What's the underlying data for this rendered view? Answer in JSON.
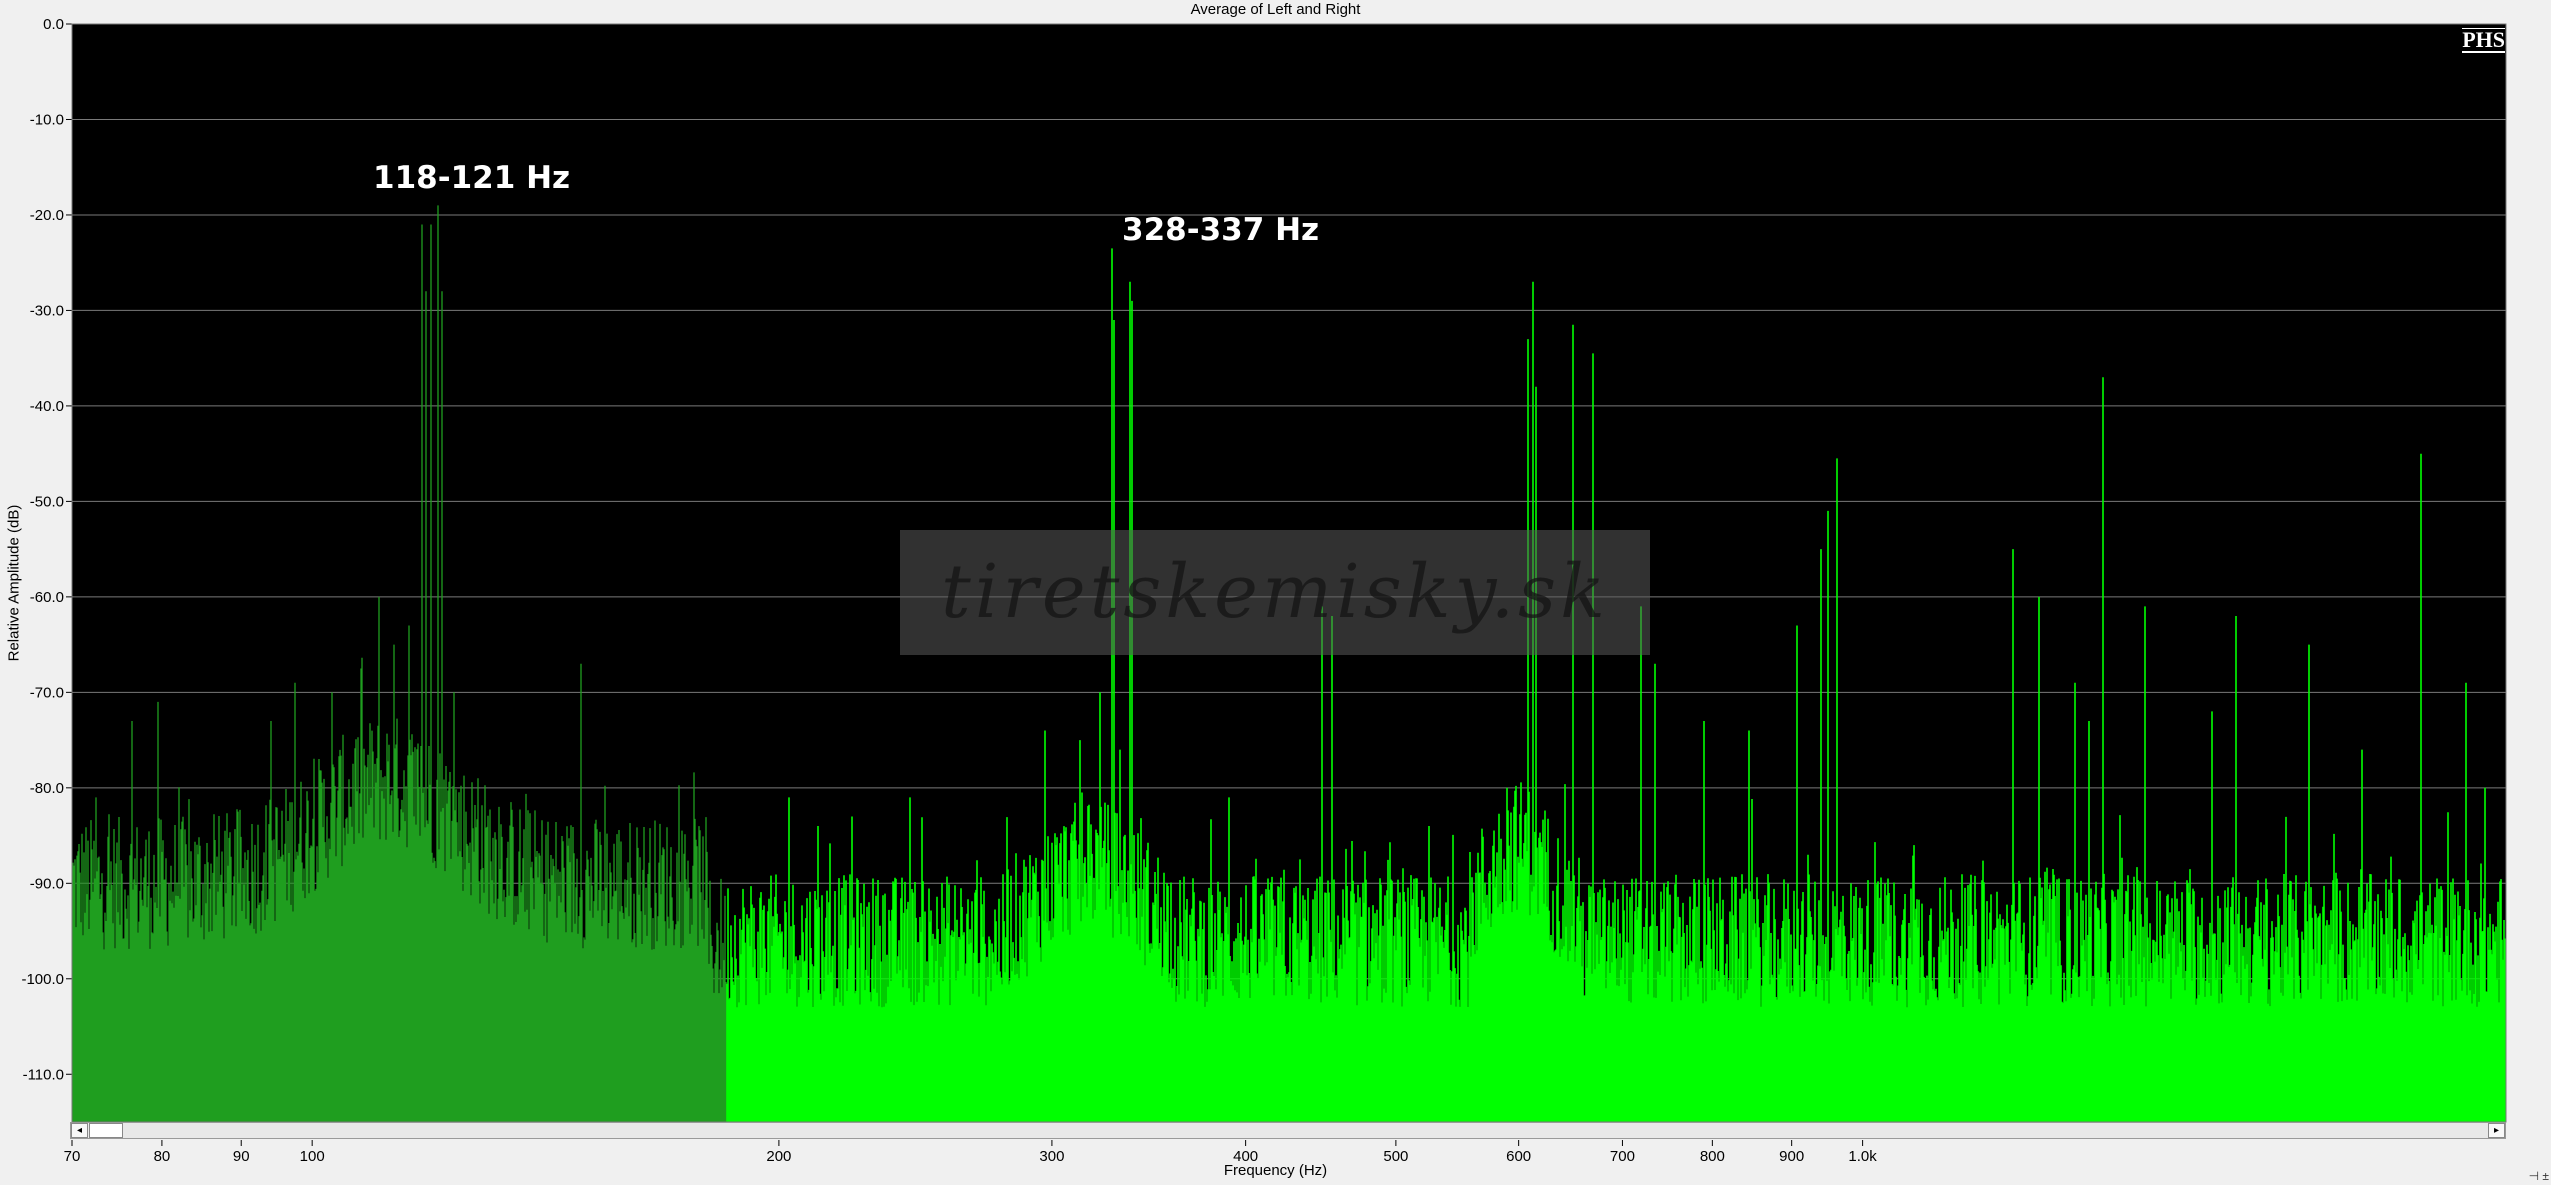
{
  "chart_data": {
    "type": "area",
    "title": "Average of Left and Right",
    "xlabel": "Frequency (Hz)",
    "ylabel": "Relative Amplitude (dB)",
    "x_scale": "log",
    "xlim": [
      70,
      2600
    ],
    "ylim": [
      -115,
      0
    ],
    "x_ticks": [
      70,
      80,
      90,
      100,
      200,
      300,
      400,
      500,
      600,
      700,
      800,
      900,
      1000
    ],
    "x_tick_labels": [
      "70",
      "80",
      "90",
      "100",
      "200",
      "300",
      "400",
      "500",
      "600",
      "700",
      "800",
      "900",
      "1.0k"
    ],
    "y_ticks": [
      0,
      -10,
      -20,
      -30,
      -40,
      -50,
      -60,
      -70,
      -80,
      -90,
      -100,
      -110
    ],
    "y_tick_labels": [
      "0.0",
      "-10.0",
      "-20.0",
      "-30.0",
      "-40.0",
      "-50.0",
      "-60.0",
      "-70.0",
      "-80.0",
      "-90.0",
      "-100.0",
      "-110.0"
    ],
    "grid": true,
    "background_color": "#000000",
    "series_color": "#00ff00",
    "series_color_dark": "#1f9e1f",
    "peaks": [
      {
        "x": 72.5,
        "y": -81
      },
      {
        "x": 76.5,
        "y": -73
      },
      {
        "x": 79.5,
        "y": -71
      },
      {
        "x": 94,
        "y": -73
      },
      {
        "x": 97.5,
        "y": -69
      },
      {
        "x": 103,
        "y": -70
      },
      {
        "x": 107.5,
        "y": -67.5
      },
      {
        "x": 110.5,
        "y": -60
      },
      {
        "x": 113,
        "y": -65
      },
      {
        "x": 115.5,
        "y": -63
      },
      {
        "x": 117.8,
        "y": -21
      },
      {
        "x": 118.5,
        "y": -28
      },
      {
        "x": 119.3,
        "y": -21
      },
      {
        "x": 120.5,
        "y": -19
      },
      {
        "x": 121.2,
        "y": -28
      },
      {
        "x": 123.5,
        "y": -70
      },
      {
        "x": 128,
        "y": -79
      },
      {
        "x": 132,
        "y": -82
      },
      {
        "x": 149,
        "y": -67
      },
      {
        "x": 155,
        "y": -86
      },
      {
        "x": 203,
        "y": -81
      },
      {
        "x": 212,
        "y": -84
      },
      {
        "x": 223,
        "y": -83
      },
      {
        "x": 243,
        "y": -81
      },
      {
        "x": 297,
        "y": -74
      },
      {
        "x": 313,
        "y": -75
      },
      {
        "x": 322,
        "y": -70
      },
      {
        "x": 328,
        "y": -23.5
      },
      {
        "x": 329,
        "y": -31
      },
      {
        "x": 332,
        "y": -76
      },
      {
        "x": 337,
        "y": -27
      },
      {
        "x": 338,
        "y": -29
      },
      {
        "x": 390,
        "y": -81
      },
      {
        "x": 448,
        "y": -61
      },
      {
        "x": 455,
        "y": -62
      },
      {
        "x": 525,
        "y": -84
      },
      {
        "x": 590,
        "y": -80
      },
      {
        "x": 608,
        "y": -33
      },
      {
        "x": 613,
        "y": -27
      },
      {
        "x": 616,
        "y": -38
      },
      {
        "x": 650,
        "y": -31.5
      },
      {
        "x": 670,
        "y": -34.5
      },
      {
        "x": 720,
        "y": -61
      },
      {
        "x": 735,
        "y": -67
      },
      {
        "x": 790,
        "y": -73
      },
      {
        "x": 845,
        "y": -74
      },
      {
        "x": 907,
        "y": -63
      },
      {
        "x": 940,
        "y": -55
      },
      {
        "x": 950,
        "y": -51
      },
      {
        "x": 962,
        "y": -45.5
      },
      {
        "x": 1080,
        "y": -86
      },
      {
        "x": 1250,
        "y": -55
      },
      {
        "x": 1300,
        "y": -60
      },
      {
        "x": 1370,
        "y": -69
      },
      {
        "x": 1400,
        "y": -73
      },
      {
        "x": 1430,
        "y": -37
      },
      {
        "x": 1520,
        "y": -61
      },
      {
        "x": 1680,
        "y": -72
      },
      {
        "x": 1740,
        "y": -62
      },
      {
        "x": 1940,
        "y": -65
      },
      {
        "x": 2100,
        "y": -76
      },
      {
        "x": 2290,
        "y": -45
      },
      {
        "x": 2450,
        "y": -69
      },
      {
        "x": 2520,
        "y": -80
      }
    ]
  },
  "annotations": [
    {
      "text": "118-121 Hz"
    },
    {
      "text": "328-337 Hz"
    }
  ],
  "logo": "PHS",
  "watermark": "tiretskemisky.sk"
}
